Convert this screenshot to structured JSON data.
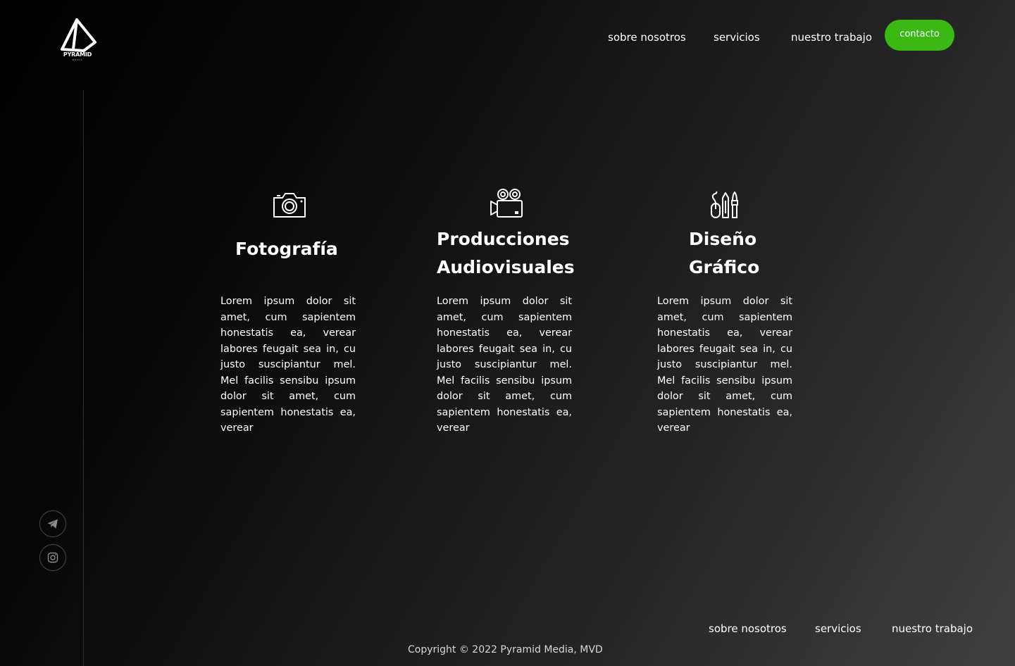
{
  "brand": {
    "name": "PYRAMID",
    "sub": "MEDIA"
  },
  "nav": {
    "items": [
      "sobre nosotros",
      "servicios",
      "nuestro trabajo"
    ],
    "contact_label": "contacto"
  },
  "accent_color": "#3cb815",
  "social": [
    {
      "icon": "telegram-icon"
    },
    {
      "icon": "instagram-icon"
    }
  ],
  "services": [
    {
      "icon": "camera-icon",
      "title_line1": "Fotografía",
      "title_line2": "",
      "text": "Lorem ipsum dolor sit amet, cum sapientem honestatis ea, verear labores feugait sea in, cu justo suscipiantur mel. Mel facilis sensibu ipsum dolor sit amet, cum sapientem honestatis ea, verear"
    },
    {
      "icon": "video-camera-icon",
      "title_line1": "Producciones",
      "title_line2": "Audiovisuales",
      "text": "Lorem ipsum dolor sit amet, cum sapientem honestatis ea, verear labores feugait sea in, cu justo suscipiantur mel. Mel facilis sensibu ipsum dolor sit amet, cum sapientem honestatis ea, verear"
    },
    {
      "icon": "design-tools-icon",
      "title_line1": "Diseño",
      "title_line2": "Gráfico",
      "text": "Lorem ipsum dolor sit amet, cum sapientem honestatis ea, verear labores feugait sea in, cu justo suscipiantur mel. Mel facilis sensibu ipsum dolor sit amet, cum sapientem honestatis ea, verear"
    }
  ],
  "footer": {
    "nav": [
      "sobre nosotros",
      "servicios",
      "nuestro trabajo"
    ],
    "copyright": "Copyright © 2022 Pyramid Media, MVD"
  }
}
